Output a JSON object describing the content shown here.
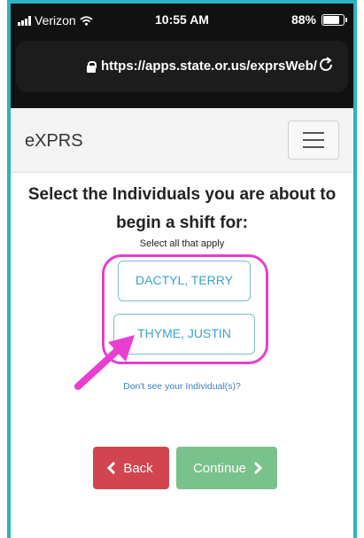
{
  "status_bar": {
    "carrier": "Verizon",
    "time": "10:55 AM",
    "battery": "88%",
    "battery_level": 0.88
  },
  "browser": {
    "url": "https://apps.state.or.us/exprsWeb/"
  },
  "navbar": {
    "brand": "eXPRS"
  },
  "page": {
    "heading": "Select the Individuals you are about to begin a shift for:",
    "subheading": "Select all that apply",
    "individuals": [
      "DACTYL, TERRY",
      "THYME, JUSTIN"
    ],
    "help_link": "Don't see your Individual(s)?",
    "back_label": "Back",
    "continue_label": "Continue"
  },
  "colors": {
    "frame": "#2bb2c4",
    "highlight": "#e33fcf",
    "back_button": "#d0454f",
    "continue_button": "#79c28b",
    "link": "#3a82c4"
  },
  "icons": [
    "signal-icon",
    "wifi-icon",
    "battery-icon",
    "lock-icon",
    "reload-icon",
    "hamburger-icon",
    "chevron-left-icon",
    "chevron-right-icon",
    "annotation-arrow-icon"
  ]
}
